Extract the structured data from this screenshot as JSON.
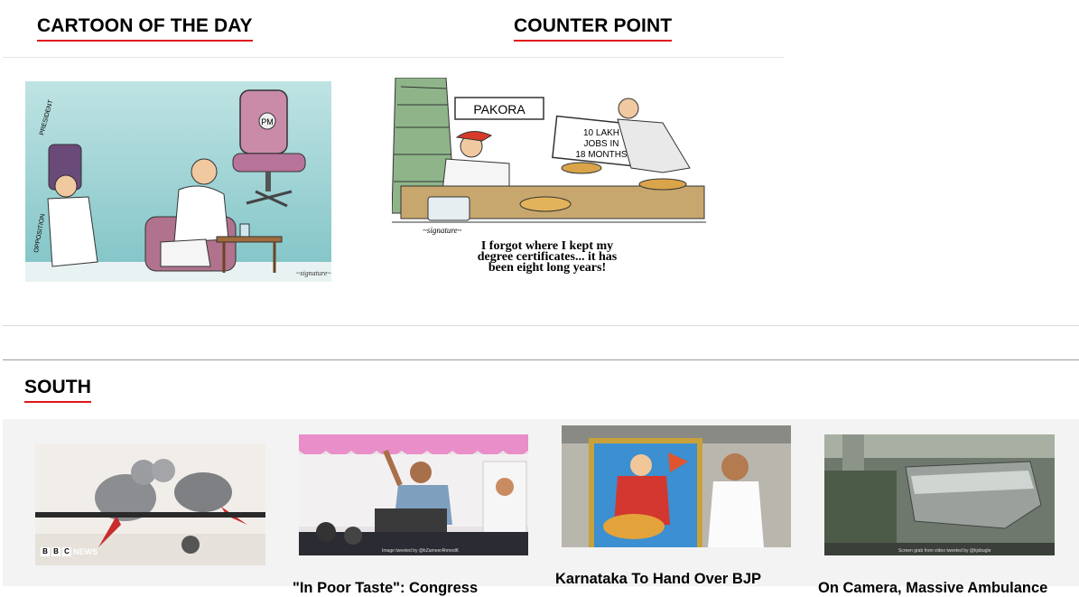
{
  "sections": {
    "cartoon_heading": "CARTOON OF THE DAY",
    "counter_heading": "COUNTER POINT",
    "south_heading": "SOUTH"
  },
  "cartoon1": {
    "labels": {
      "chair": "PM",
      "president": "PRESIDENT",
      "opposition": "OPPOSITION"
    }
  },
  "cartoon2": {
    "sign": "PAKORA",
    "placard": [
      "10 LAKH",
      "JOBS IN",
      "18 MONTHS"
    ],
    "caption": [
      "I forgot where I kept my",
      "degree certificates... it has",
      "been eight long years!"
    ]
  },
  "south_stories": [
    {
      "title": "",
      "overlay": "NEWS",
      "credit": ""
    },
    {
      "title": "\"In Poor Taste\": Congress",
      "credit": "Image tweeted by @bZameerAhmedK"
    },
    {
      "title": "Karnataka To Hand Over BJP",
      "credit": ""
    },
    {
      "title": "On Camera, Massive Ambulance",
      "credit": "Screen grab from video tweeted by @kjsbugle"
    }
  ]
}
